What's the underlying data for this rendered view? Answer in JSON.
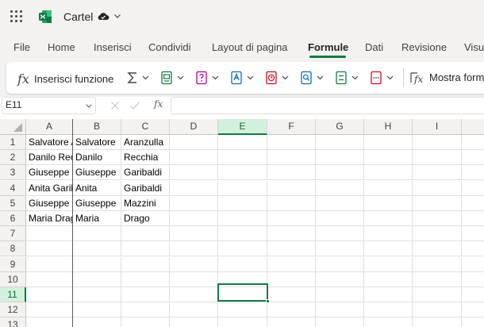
{
  "app": {
    "title": "Cartel",
    "icons": {
      "launcher": "waffle-grid-icon",
      "logo": "excel-logo-icon",
      "save_status": "cloud-saved-icon",
      "menu": "chevron-down-icon"
    }
  },
  "menu": {
    "tabs": [
      "File",
      "Home",
      "Inserisci",
      "Condividi",
      "Layout di pagina",
      "Formule",
      "Dati",
      "Revisione",
      "Visua"
    ],
    "active": "Formule"
  },
  "ribbon": {
    "insert_function_label": "Inserisci funzione",
    "insert_function_icon": "fx",
    "groups": [
      {
        "icon": "autosum-icon"
      },
      {
        "icon": "financial-icon"
      },
      {
        "icon": "logical-icon"
      },
      {
        "icon": "text-icon"
      },
      {
        "icon": "date-time-icon"
      },
      {
        "icon": "lookup-reference-icon"
      },
      {
        "icon": "math-trig-icon"
      },
      {
        "icon": "more-functions-icon"
      }
    ],
    "show_formulas_label": "Mostra form"
  },
  "formula_bar": {
    "name_box": "E11",
    "fx_label": "fx",
    "value": ""
  },
  "sheet": {
    "columns": [
      "A",
      "B",
      "C",
      "D",
      "E",
      "F",
      "G",
      "H",
      "I"
    ],
    "rows": [
      "1",
      "2",
      "3",
      "4",
      "5",
      "6",
      "7",
      "8",
      "9",
      "10",
      "11",
      "12",
      "13"
    ],
    "selected_column": "E",
    "selected_row": "11",
    "cells": [
      [
        "Salvatore Aranzulla",
        "Salvatore",
        "Aranzulla"
      ],
      [
        "Danilo Recchia",
        "Danilo",
        "Recchia"
      ],
      [
        "Giuseppe Garibaldi",
        "Giuseppe",
        "Garibaldi"
      ],
      [
        "Anita Garibaldi",
        "Anita",
        "Garibaldi"
      ],
      [
        "Giuseppe Mazzini",
        "Giuseppe",
        "Mazzini"
      ],
      [
        "Maria Drago",
        "Maria",
        "Drago"
      ]
    ]
  },
  "colors": {
    "accent": "#107c41",
    "selection_fill": "#d3f0dc",
    "chrome": "#f3f2f1"
  }
}
